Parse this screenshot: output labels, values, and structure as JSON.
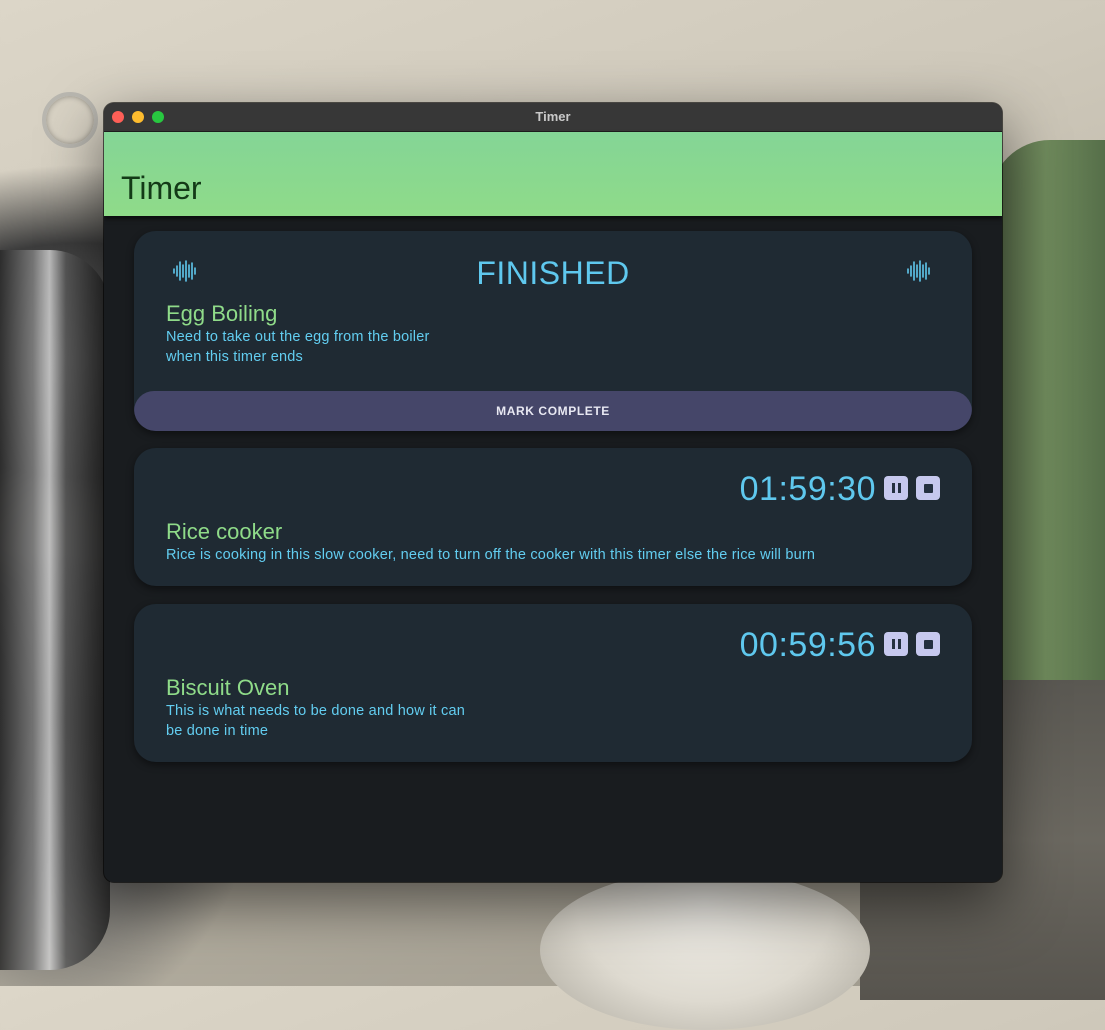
{
  "window": {
    "title": "Timer"
  },
  "appbar": {
    "title": "Timer"
  },
  "timers": [
    {
      "status": "FINISHED",
      "name": "Egg Boiling",
      "description": "Need to take out the egg from the boiler when this timer ends",
      "action_label": "MARK COMPLETE"
    },
    {
      "time": "01:59:30",
      "name": "Rice cooker",
      "description": "Rice is cooking in this slow cooker, need to turn off the cooker with this timer else the rice will burn"
    },
    {
      "time": "00:59:56",
      "name": "Biscuit Oven",
      "description": "This is what needs to be done and how it can be done in time"
    }
  ],
  "icons": {
    "waveform": "audio-waveform-icon",
    "pause": "pause-icon",
    "stop": "stop-icon",
    "add": "add-circle-icon"
  },
  "colors": {
    "appbar": "#8fdb89",
    "card_bg": "#1f2a33",
    "accent_blue": "#5fc8ee",
    "accent_green": "#8fdb89",
    "mark_complete_bg": "#454669",
    "fab_bg": "#064a60",
    "window_bg": "#191c1f"
  }
}
